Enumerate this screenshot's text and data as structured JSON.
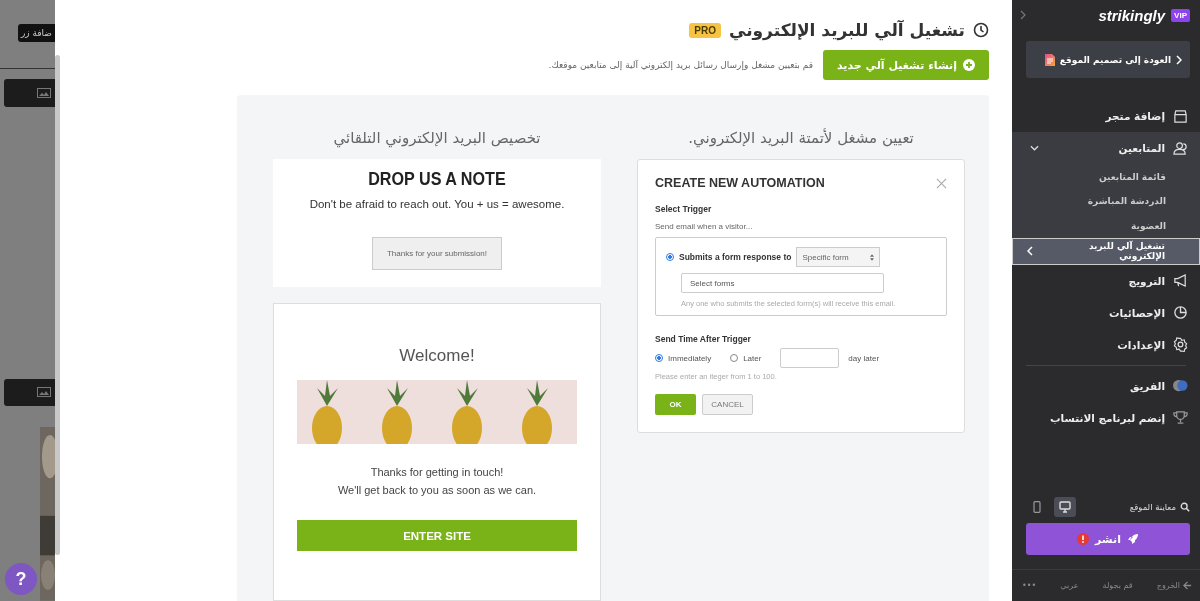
{
  "backdrop": {
    "button_label": "ضافة زر"
  },
  "help_button": {
    "label": "?"
  },
  "header": {
    "title": "تشغيل آلي للبريد الإلكتروني",
    "badge": "PRO",
    "create_button": "إنشاء تشغيل آلي جديد",
    "description": "قم بتعيين مشغل وإرسال رسائل بريد إلكتروني آلية إلى متابعين موقعك."
  },
  "preview": {
    "heading": "تخصيص البريد الإلكتروني التلقائي",
    "form_card": {
      "title": "DROP US A NOTE",
      "text": "Don't be afraid to reach out. You + us = awesome.",
      "button": "Thanks for your submission!"
    },
    "email_card": {
      "title": "Welcome!",
      "line_1": "Thanks for getting in touch!",
      "line_2": "We'll get back to you as soon as we can.",
      "button": "ENTER SITE"
    }
  },
  "automation": {
    "heading": "تعيين مشغل لأتمتة البريد الإلكتروني.",
    "dialog": {
      "title": "CREATE NEW AUTOMATION",
      "trigger_label": "Select Trigger",
      "trigger_hint": "Send email when a visitor...",
      "trigger_option": {
        "label": "Submits a form response to",
        "selected": true
      },
      "select_value": "Specific form",
      "forms_placeholder": "Select forms",
      "forms_note": "Any one who submits the selected form(s) will receive this email.",
      "send_time_label": "Send Time After Trigger",
      "immediately_option": {
        "label": "Immediately",
        "selected": true
      },
      "later_option": {
        "label": "Later",
        "selected": false
      },
      "days_suffix": "day later",
      "days_hint": "Please enter an iteger  from 1 to 100.",
      "ok": "OK",
      "cancel": "CANCEL"
    }
  },
  "sidebar": {
    "badge": "VIP",
    "logo": "strikingly",
    "back_button": "العودة إلى تصميم الموقع",
    "items": [
      {
        "label": "إضافة متجر",
        "selected": false,
        "expanded": false
      },
      {
        "label": "المتابعين",
        "selected": false,
        "expanded": true,
        "children": [
          {
            "label": "قائمة المتابعين",
            "selected": false
          },
          {
            "label": "الدردشة المباشرة",
            "selected": false
          },
          {
            "label": "العضوية",
            "selected": false
          },
          {
            "label": "تشغيل آلي للبريد الإلكتروني",
            "selected": true
          }
        ]
      },
      {
        "label": "الترويج",
        "selected": false,
        "expanded": false
      },
      {
        "label": "الإحصائيات",
        "selected": false,
        "expanded": false
      },
      {
        "label": "الإعدادات",
        "selected": false,
        "expanded": false
      },
      {
        "label": "الفريق",
        "selected": false,
        "expanded": false
      },
      {
        "label": "إنضم لبرنامج الانتساب",
        "selected": false,
        "expanded": false
      }
    ],
    "devices": [
      {
        "kind": "desktop",
        "selected": true
      },
      {
        "kind": "mobile",
        "selected": false
      }
    ],
    "preview_link": "معاينة الموقع",
    "publish_button": "انشر",
    "footer": [
      {
        "kind": "exit",
        "label": "الخروج"
      },
      {
        "kind": "text",
        "label": "قم بجولة"
      },
      {
        "kind": "text",
        "label": "عربي"
      },
      {
        "kind": "text",
        "label": "•••"
      }
    ]
  }
}
